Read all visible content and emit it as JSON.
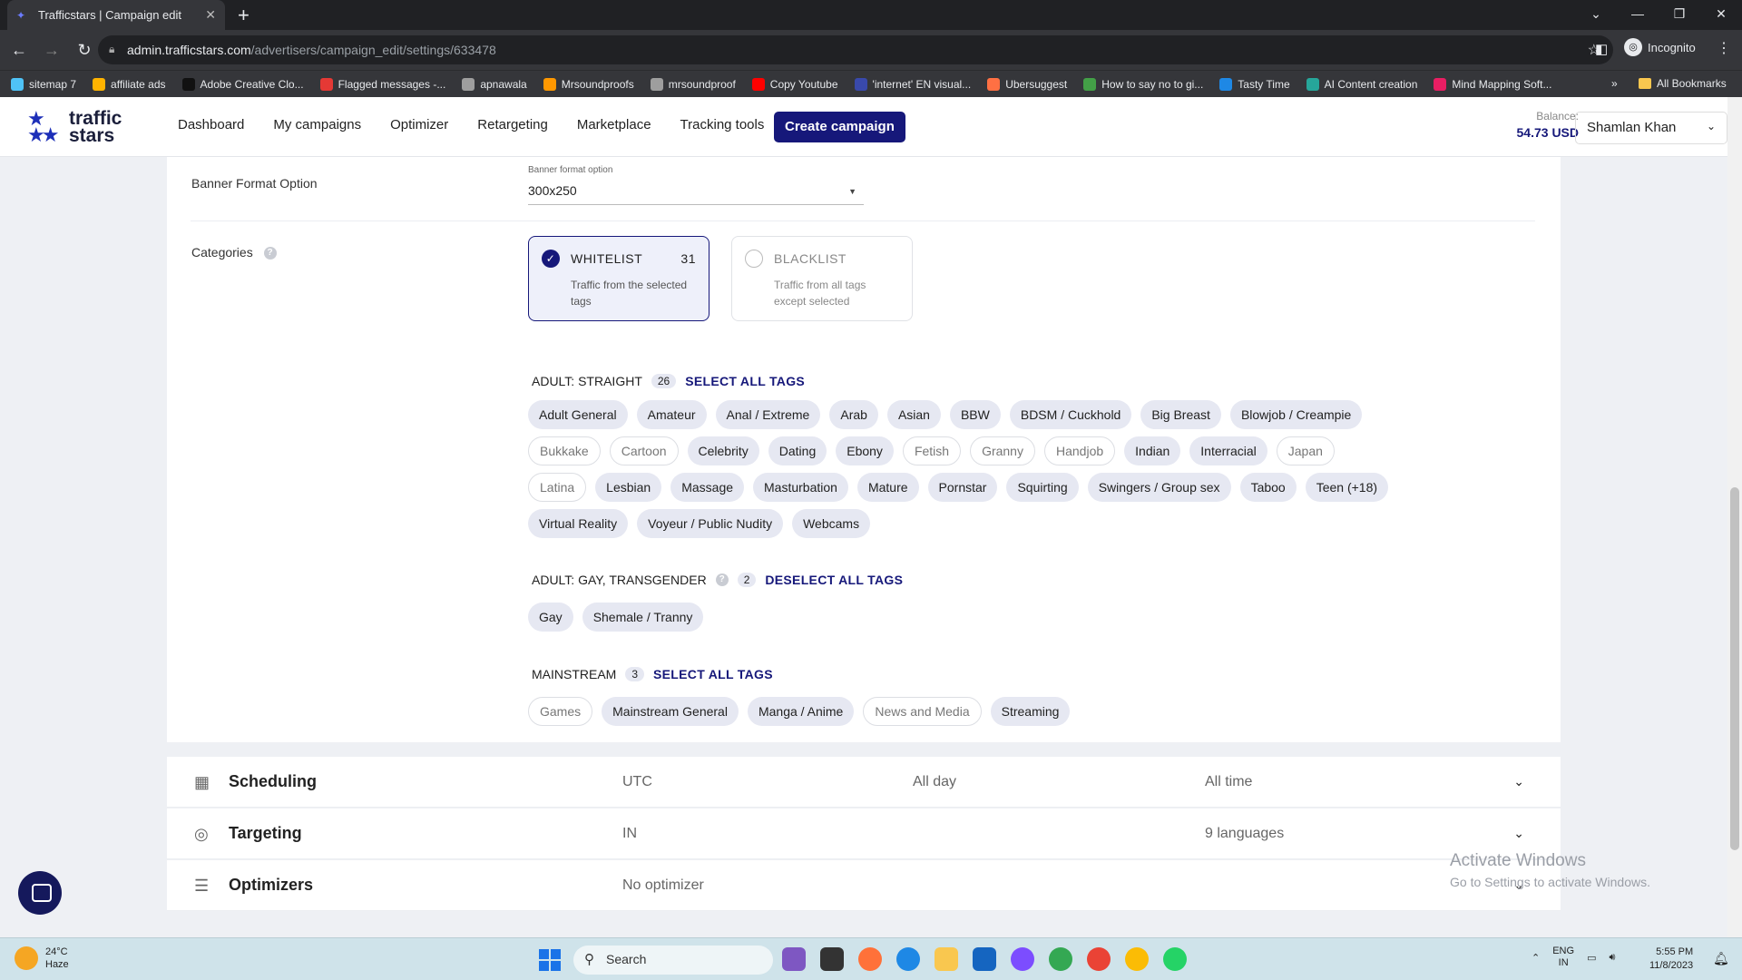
{
  "browser": {
    "tab_title": "Trafficstars | Campaign edit",
    "url_host": "admin.trafficstars.com",
    "url_path": "/advertisers/campaign_edit/settings/633478",
    "incognito_label": "Incognito",
    "bookmarks": [
      {
        "label": "sitemap 7",
        "color": "#4fc3f7"
      },
      {
        "label": "affiliate ads",
        "color": "#ffb300"
      },
      {
        "label": "Adobe Creative Clo...",
        "color": "#111111"
      },
      {
        "label": "Flagged messages -...",
        "color": "#e53935"
      },
      {
        "label": "apnawala",
        "color": "#9e9e9e"
      },
      {
        "label": "Mrsoundproofs",
        "color": "#ff9800"
      },
      {
        "label": "mrsoundproof",
        "color": "#9e9e9e"
      },
      {
        "label": "Copy Youtube",
        "color": "#ff0000"
      },
      {
        "label": "'internet' EN visual...",
        "color": "#3949ab"
      },
      {
        "label": "Ubersuggest",
        "color": "#ff7043"
      },
      {
        "label": "How to say no to gi...",
        "color": "#43a047"
      },
      {
        "label": "Tasty Time",
        "color": "#1e88e5"
      },
      {
        "label": "AI Content creation",
        "color": "#26a69a"
      },
      {
        "label": "Mind Mapping Soft...",
        "color": "#e91e63"
      }
    ],
    "all_bookmarks": "All Bookmarks"
  },
  "header": {
    "logo_line1": "traffic",
    "logo_line2": "stars",
    "nav": [
      "Dashboard",
      "My campaigns",
      "Optimizer",
      "Retargeting",
      "Marketplace",
      "Tracking tools"
    ],
    "cta": "Create campaign",
    "balance_label": "Balance:",
    "balance_value": "54.73 USD",
    "user_name": "Shamlan Khan"
  },
  "banner": {
    "row_label": "Banner Format Option",
    "field_label": "Banner format option",
    "value": "300x250"
  },
  "categories": {
    "row_label": "Categories",
    "whitelist": {
      "title": "WHITELIST",
      "count": "31",
      "desc": "Traffic from the selected tags",
      "selected": true
    },
    "blacklist": {
      "title": "BLACKLIST",
      "desc": "Traffic from all tags except selected",
      "selected": false
    },
    "groups": [
      {
        "title": "ADULT: STRAIGHT",
        "count": "26",
        "action": "SELECT ALL TAGS",
        "help": false,
        "tags": [
          {
            "label": "Adult General",
            "on": true
          },
          {
            "label": "Amateur",
            "on": true
          },
          {
            "label": "Anal / Extreme",
            "on": true
          },
          {
            "label": "Arab",
            "on": true
          },
          {
            "label": "Asian",
            "on": true
          },
          {
            "label": "BBW",
            "on": true
          },
          {
            "label": "BDSM / Cuckhold",
            "on": true
          },
          {
            "label": "Big Breast",
            "on": true
          },
          {
            "label": "Blowjob / Creampie",
            "on": true
          },
          {
            "label": "Bukkake",
            "on": false
          },
          {
            "label": "Cartoon",
            "on": false
          },
          {
            "label": "Celebrity",
            "on": true
          },
          {
            "label": "Dating",
            "on": true
          },
          {
            "label": "Ebony",
            "on": true
          },
          {
            "label": "Fetish",
            "on": false
          },
          {
            "label": "Granny",
            "on": false
          },
          {
            "label": "Handjob",
            "on": false
          },
          {
            "label": "Indian",
            "on": true
          },
          {
            "label": "Interracial",
            "on": true
          },
          {
            "label": "Japan",
            "on": false
          },
          {
            "label": "Latina",
            "on": false
          },
          {
            "label": "Lesbian",
            "on": true
          },
          {
            "label": "Massage",
            "on": true
          },
          {
            "label": "Masturbation",
            "on": true
          },
          {
            "label": "Mature",
            "on": true
          },
          {
            "label": "Pornstar",
            "on": true
          },
          {
            "label": "Squirting",
            "on": true
          },
          {
            "label": "Swingers / Group sex",
            "on": true
          },
          {
            "label": "Taboo",
            "on": true
          },
          {
            "label": "Teen (+18)",
            "on": true
          },
          {
            "label": "Virtual Reality",
            "on": true
          },
          {
            "label": "Voyeur / Public Nudity",
            "on": true
          },
          {
            "label": "Webcams",
            "on": true
          }
        ]
      },
      {
        "title": "ADULT: GAY, TRANSGENDER",
        "count": "2",
        "action": "DESELECT ALL TAGS",
        "help": true,
        "tags": [
          {
            "label": "Gay",
            "on": true
          },
          {
            "label": "Shemale / Tranny",
            "on": true
          }
        ]
      },
      {
        "title": "MAINSTREAM",
        "count": "3",
        "action": "SELECT ALL TAGS",
        "help": false,
        "tags": [
          {
            "label": "Games",
            "on": false
          },
          {
            "label": "Mainstream General",
            "on": true
          },
          {
            "label": "Manga / Anime",
            "on": true
          },
          {
            "label": "News and Media",
            "on": false
          },
          {
            "label": "Streaming",
            "on": true
          }
        ]
      }
    ]
  },
  "sections": [
    {
      "icon": "calendar-icon",
      "title": "Scheduling",
      "c1": "UTC",
      "c2": "All day",
      "c3": "All time"
    },
    {
      "icon": "target-icon",
      "title": "Targeting",
      "c1": "IN",
      "c2": "",
      "c3": "9 languages"
    },
    {
      "icon": "list-check-icon",
      "title": "Optimizers",
      "c1": "No optimizer",
      "c2": "",
      "c3": ""
    }
  ],
  "watermark": {
    "line1": "Activate Windows",
    "line2": "Go to Settings to activate Windows."
  },
  "taskbar": {
    "temp": "24°C",
    "weather": "Haze",
    "search": "Search",
    "lang1": "ENG",
    "lang2": "IN",
    "time": "5:55 PM",
    "date": "11/8/2023"
  }
}
